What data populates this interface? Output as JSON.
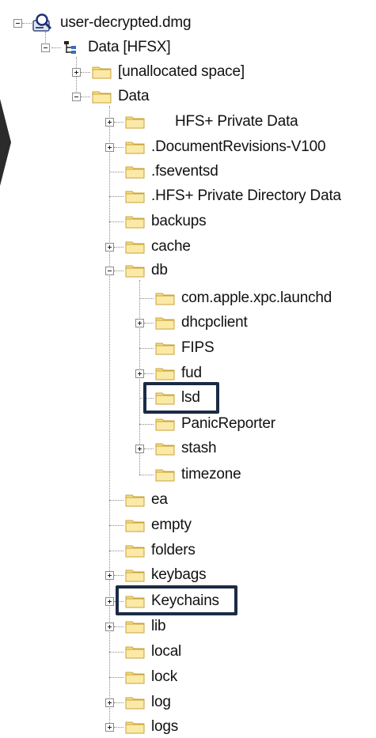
{
  "tree": {
    "root": {
      "label": "user-decrypted.dmg",
      "icon": "disk-image-magnifier-icon"
    },
    "volume": {
      "label": "Data [HFSX]",
      "icon": "volume-tree-icon"
    },
    "unallocated": {
      "label": "[unallocated space]"
    },
    "data": {
      "label": "Data"
    },
    "data_children": [
      {
        "label": "HFS+ Private Data",
        "expandable": true
      },
      {
        "label": ".DocumentRevisions-V100",
        "expandable": true
      },
      {
        "label": ".fseventsd",
        "expandable": false
      },
      {
        "label": ".HFS+ Private Directory Data",
        "expandable": false
      },
      {
        "label": "backups",
        "expandable": false
      },
      {
        "label": "cache",
        "expandable": true
      },
      {
        "label": "db",
        "expandable": true,
        "expanded": true
      }
    ],
    "db_children": [
      {
        "label": "com.apple.xpc.launchd",
        "expandable": false
      },
      {
        "label": "dhcpclient",
        "expandable": true
      },
      {
        "label": "FIPS",
        "expandable": false
      },
      {
        "label": "fud",
        "expandable": true
      },
      {
        "label": "lsd",
        "expandable": false,
        "highlighted": true
      },
      {
        "label": "PanicReporter",
        "expandable": false
      },
      {
        "label": "stash",
        "expandable": true
      },
      {
        "label": "timezone",
        "expandable": false
      }
    ],
    "data_children_after": [
      {
        "label": "ea",
        "expandable": false
      },
      {
        "label": "empty",
        "expandable": false
      },
      {
        "label": "folders",
        "expandable": false
      },
      {
        "label": "keybags",
        "expandable": true
      },
      {
        "label": "Keychains",
        "expandable": true,
        "highlighted": true
      },
      {
        "label": "lib",
        "expandable": true
      },
      {
        "label": "local",
        "expandable": false
      },
      {
        "label": "lock",
        "expandable": false
      },
      {
        "label": "log",
        "expandable": true
      },
      {
        "label": "logs",
        "expandable": true
      }
    ]
  },
  "colors": {
    "folder_fill": "#f7df86",
    "folder_edge": "#c9a33a",
    "highlight_border": "#1b2b45"
  }
}
